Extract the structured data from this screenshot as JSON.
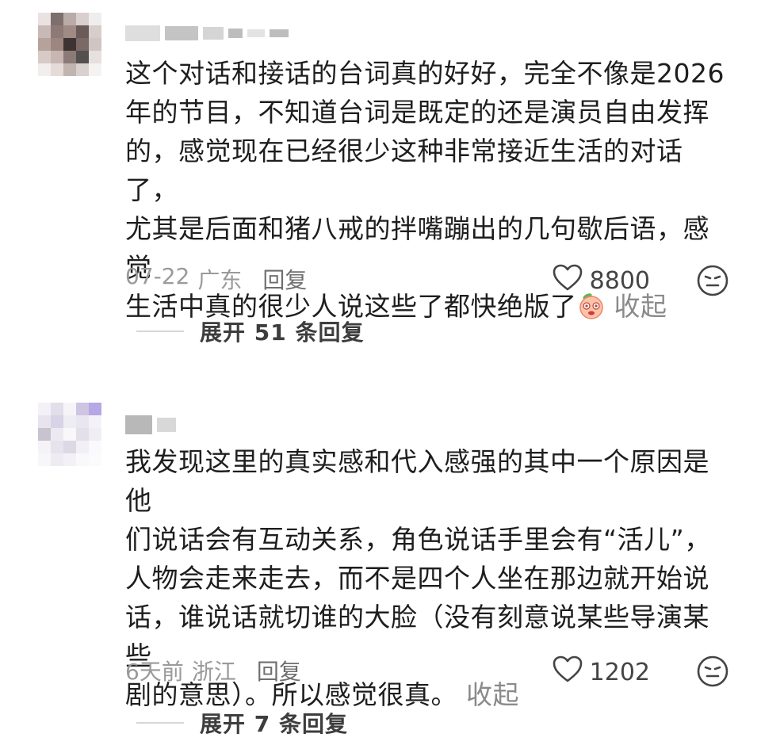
{
  "comments": [
    {
      "text": "这个对话和接话的台词真的好好，完全不像是2026\n年的节目，不知道台词是既定的还是演员自由发挥\n的，感觉现在已经很少这种非常接近生活的对话了，\n尤其是后面和猪八戒的拌嘴蹦出的几句歇后语，感觉\n生活中真的很少人说这些了都快绝版了",
      "emoji_icon": "peach-crying-emoji-icon",
      "collapse_label": " 收起",
      "date": "07-22",
      "location": "广东",
      "reply_label": "回复",
      "likes": "8800",
      "expand_label": "展开 51 条回复"
    },
    {
      "text": "我发现这里的真实感和代入感强的其中一个原因是他\n们说话会有互动关系，角色说话手里会有“活儿”，\n人物会走来走去，而不是四个人坐在那边就开始说\n话，谁说话就切谁的大脸（没有刻意说某些导演某些\n剧的意思）。所以感觉很真。",
      "collapse_label": " 收起",
      "date": "6天前",
      "location": "浙江",
      "reply_label": "回复",
      "likes": "1202",
      "expand_label": "展开 7 条回复"
    }
  ],
  "icons": {
    "like": "heart-outline-icon",
    "dislike": "unhappy-face-icon"
  },
  "colors": {
    "text": "#1e1e1e",
    "muted": "#9a9a9a",
    "link_gray": "#8a8a8a"
  }
}
